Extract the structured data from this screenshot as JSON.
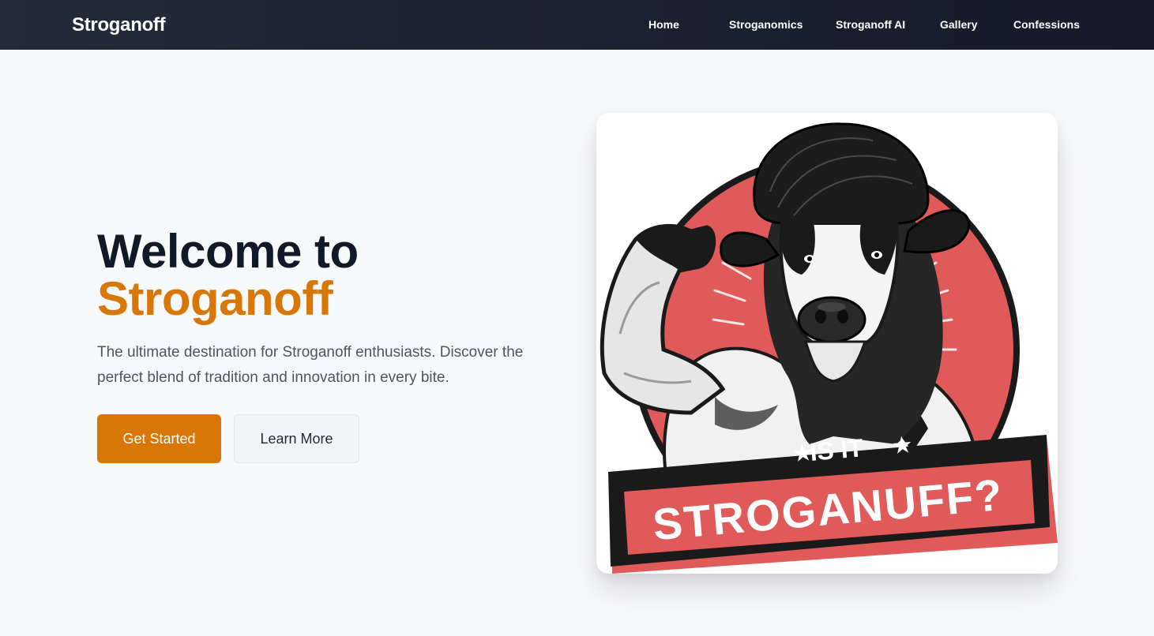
{
  "nav": {
    "brand": "Stroganoff",
    "links": [
      "Home",
      "Stroganomics",
      "Stroganoff AI",
      "Gallery",
      "Confessions"
    ]
  },
  "hero": {
    "title_line1": "Welcome to",
    "title_line2": "Stroganoff",
    "subtitle": "The ultimate destination for Stroganoff enthusiasts. Discover the perfect blend of tradition and innovation in every bite.",
    "primary_button": "Get Started",
    "secondary_button": "Learn More"
  },
  "illustration": {
    "banner_top": "IS IT",
    "banner_main": "STROGANUFF?",
    "star_symbol": "★"
  },
  "colors": {
    "accent": "#d97706",
    "heading": "#111827",
    "nav_bg": "#1a2130",
    "badge_red": "#e05a5a"
  }
}
